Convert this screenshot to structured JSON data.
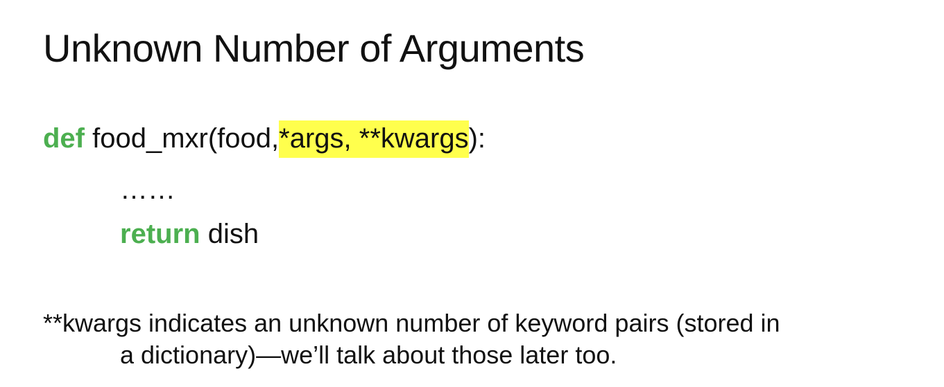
{
  "slide": {
    "title": "Unknown Number of Arguments",
    "code": {
      "def_keyword": "def",
      "def_prefix": " food_mxr(food,",
      "def_highlight": "*args, **kwargs",
      "def_suffix": "):",
      "ellipsis": "……",
      "return_keyword": "return",
      "return_rest": " dish"
    },
    "note": {
      "line1": "**kwargs indicates an unknown number of keyword pairs (stored in",
      "line2": "a dictionary)—we’ll talk about those later too."
    },
    "colors": {
      "keyword": "#4caf50",
      "highlight": "#ffff4d",
      "text": "#111111",
      "background": "#ffffff"
    }
  }
}
